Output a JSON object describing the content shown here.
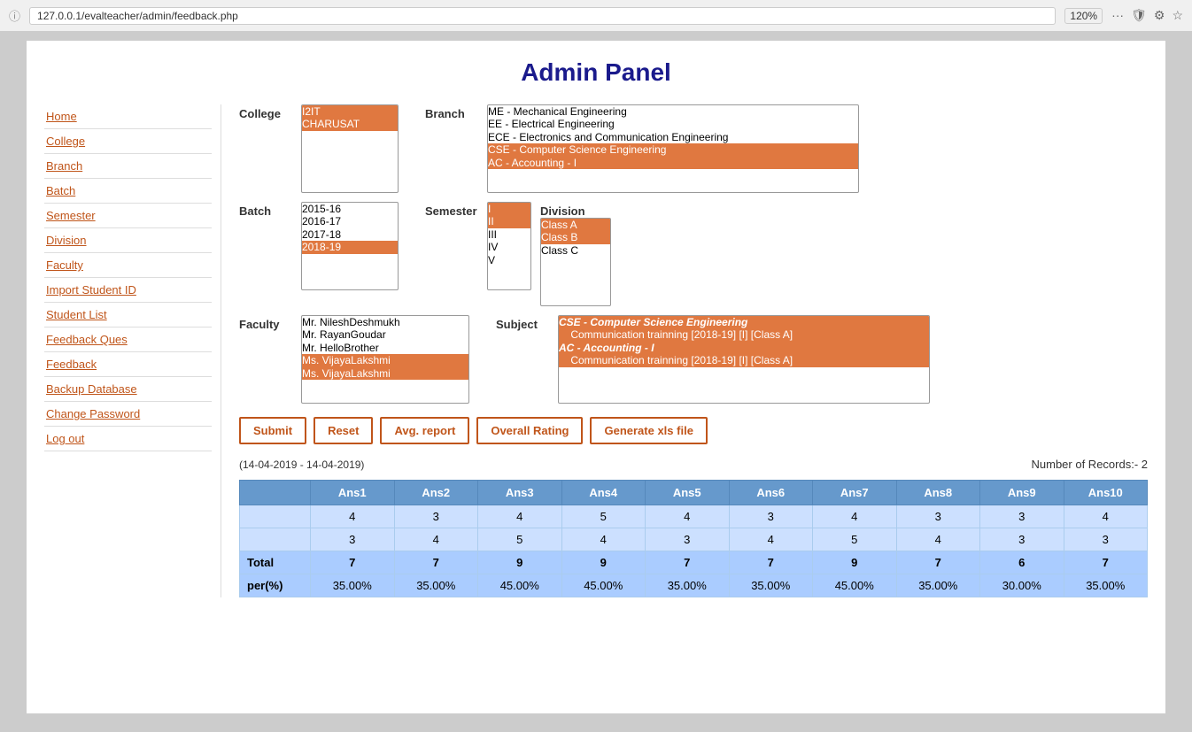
{
  "browser": {
    "url": "127.0.0.1/evalteacher/admin/feedback.php",
    "zoom": "120%"
  },
  "page": {
    "title": "Admin Panel"
  },
  "sidebar": {
    "items": [
      {
        "label": "Home",
        "href": "#"
      },
      {
        "label": "College",
        "href": "#"
      },
      {
        "label": "Branch",
        "href": "#"
      },
      {
        "label": "Batch",
        "href": "#"
      },
      {
        "label": "Semester",
        "href": "#"
      },
      {
        "label": "Division",
        "href": "#"
      },
      {
        "label": "Faculty",
        "href": "#"
      },
      {
        "label": "Import Student ID",
        "href": "#"
      },
      {
        "label": "Student List",
        "href": "#"
      },
      {
        "label": "Feedback Ques",
        "href": "#"
      },
      {
        "label": "Feedback",
        "href": "#"
      },
      {
        "label": "Backup Database",
        "href": "#"
      },
      {
        "label": "Change Password",
        "href": "#"
      },
      {
        "label": "Log out",
        "href": "#"
      }
    ]
  },
  "form": {
    "college_label": "College",
    "branch_label": "Branch",
    "batch_label": "Batch",
    "semester_label": "Semester",
    "division_label": "Division",
    "faculty_label": "Faculty",
    "subject_label": "Subject",
    "college_options": [
      "I2IT",
      "CHARUSAT"
    ],
    "branch_options": [
      "ME - Mechanical Engineering",
      "EE - Electrical Engineering",
      "ECE - Electronics and Communication Engineering",
      "CSE - Computer Science Engineering",
      "AC - Accounting - I"
    ],
    "batch_options": [
      "2015-16",
      "2016-17",
      "2017-18",
      "2018-19"
    ],
    "semester_options": [
      "I",
      "II",
      "III",
      "IV",
      "V"
    ],
    "division_options": [
      "Class A",
      "Class B",
      "Class C"
    ],
    "faculty_options": [
      "Mr. NileshDeshmukh",
      "Mr. RayanGoudar",
      "Mr. HelloBrother",
      "Ms. VijayaLakshmi",
      "Ms. VijayaLakshmi"
    ],
    "subject_options": [
      "CSE - Computer Science Engineering",
      "     Communication trainning [2018-19] [I] [Class A]",
      "AC - Accounting - I",
      "     Communication trainning [2018-19] [I] [Class A]"
    ]
  },
  "buttons": {
    "submit": "Submit",
    "reset": "Reset",
    "avg_report": "Avg. report",
    "overall_rating": "Overall Rating",
    "generate_xls": "Generate xls file"
  },
  "results": {
    "date_range": "(14-04-2019 - 14-04-2019)",
    "records_count": "Number of Records:- 2",
    "columns": [
      "Ans1",
      "Ans2",
      "Ans3",
      "Ans4",
      "Ans5",
      "Ans6",
      "Ans7",
      "Ans8",
      "Ans9",
      "Ans10"
    ],
    "rows": [
      {
        "label": "",
        "values": [
          4,
          3,
          4,
          5,
          4,
          3,
          4,
          3,
          3,
          4
        ]
      },
      {
        "label": "",
        "values": [
          3,
          4,
          5,
          4,
          3,
          4,
          5,
          4,
          3,
          3
        ]
      }
    ],
    "total_label": "Total",
    "total_values": [
      7,
      7,
      9,
      9,
      7,
      7,
      9,
      7,
      6,
      7
    ],
    "percent_label": "per(%)",
    "percent_values": [
      "35.00%",
      "35.00%",
      "45.00%",
      "45.00%",
      "35.00%",
      "35.00%",
      "45.00%",
      "35.00%",
      "30.00%",
      "35.00%"
    ]
  }
}
